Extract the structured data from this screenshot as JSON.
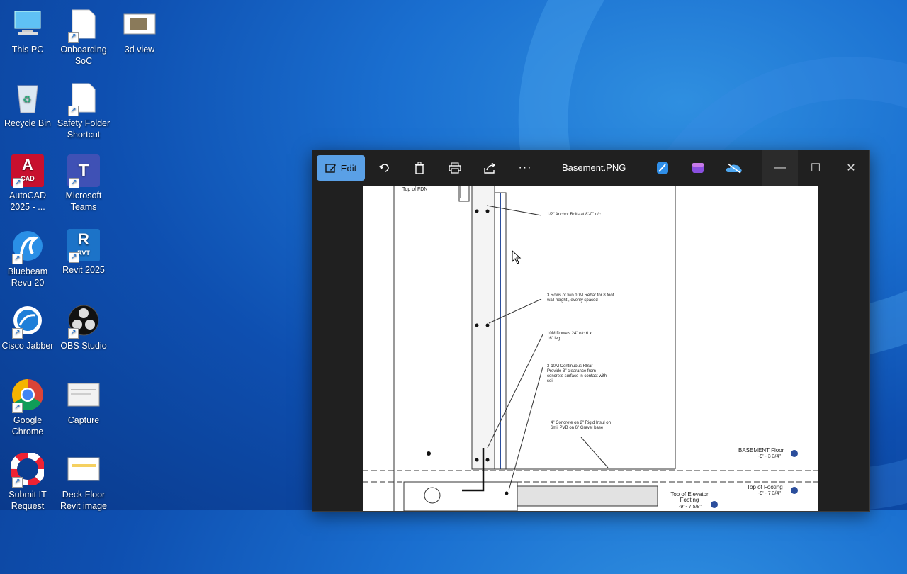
{
  "desktop": {
    "icons": [
      {
        "label": "This PC",
        "icon": "computer-icon"
      },
      {
        "label": "Onboarding SoC",
        "icon": "document-icon"
      },
      {
        "label": "3d view",
        "icon": "image-icon"
      },
      {
        "label": "Recycle Bin",
        "icon": "recycle-bin-icon"
      },
      {
        "label": "Safety Folder Shortcut",
        "icon": "document-icon"
      },
      {
        "label": "AutoCAD 2025 - ...",
        "icon": "autocad-icon",
        "badge": "CAD",
        "letter": "A"
      },
      {
        "label": "Microsoft Teams",
        "icon": "teams-icon",
        "letter": "T"
      },
      {
        "label": "Bluebeam Revu 20",
        "icon": "bluebeam-icon"
      },
      {
        "label": "Revit 2025",
        "icon": "revit-icon",
        "badge": "RVT",
        "letter": "R"
      },
      {
        "label": "Cisco Jabber",
        "icon": "jabber-icon"
      },
      {
        "label": "OBS Studio",
        "icon": "obs-icon"
      },
      {
        "label": "Google Chrome",
        "icon": "chrome-icon"
      },
      {
        "label": "Capture",
        "icon": "capture-icon"
      },
      {
        "label": "Submit IT Request",
        "icon": "lifebuoy-icon"
      },
      {
        "label": "Deck Floor Revit image",
        "icon": "image-icon"
      }
    ]
  },
  "viewer": {
    "edit_label": "Edit",
    "file_title": "Basement.PNG",
    "minimize": "—",
    "maximize": "☐",
    "close": "✕",
    "more": "···"
  },
  "drawing": {
    "top_of_fdn": "Top of FDN",
    "anchor": "1/2\" Anchor Bolts at 8'-0\" o/c",
    "rebar_rows": "3 Rows of two 10M Rebar for 8 foot wall height , evenly spaced",
    "dowels": "10M Dowels 24\" o/c 6 x 16\" leg",
    "continuous": "3-10M Continuous RBar Provide 3\" clearance from concrete surface in contact with soil",
    "slab": "4\" Concrete on 2\" Rigid Insul on 6mil PVB on 6\" Gravel base",
    "basement_floor": "BASEMENT Floor",
    "basement_elev": "-9' - 3 3/4\"",
    "top_footing": "Top of Footing",
    "top_footing_elev": "-9' - 7 3/4\"",
    "elevator": "Top of Elevator Footing",
    "elevator_elev": "-9' - 7 5/8\""
  }
}
